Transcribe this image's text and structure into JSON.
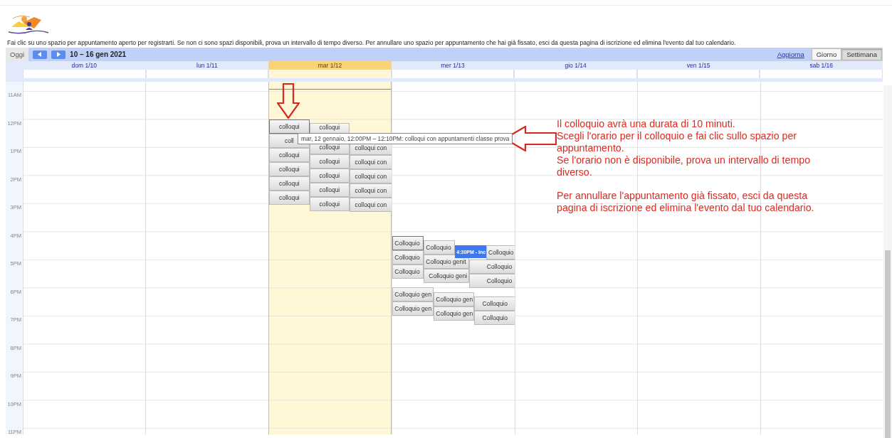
{
  "instructions": "Fai clic su uno spazio per appuntamento aperto per registrarti. Se non ci sono spazi disponibili, prova un intervallo di tempo diverso. Per annullare uno spazio per appuntamento che hai già fissato, esci da questa pagina di iscrizione ed elimina l'evento dal tuo calendario.",
  "toolbar": {
    "today": "Oggi",
    "range": "10 – 16 gen 2021",
    "refresh": "Aggiorna",
    "views": [
      {
        "label": "Giorno",
        "selected": false
      },
      {
        "label": "Settimana",
        "selected": true
      }
    ]
  },
  "days": [
    {
      "label": "dom 1/10",
      "today": false
    },
    {
      "label": "lun 1/11",
      "today": false
    },
    {
      "label": "mar 1/12",
      "today": true,
      "events": [
        {
          "label": "colloqui",
          "kind": "slot"
        },
        {
          "label": "coll",
          "kind": "slot"
        },
        {
          "label": "colloqui",
          "kind": "slot"
        },
        {
          "label": "colloqui",
          "kind": "slot"
        },
        {
          "label": "colloqui",
          "kind": "slot"
        },
        {
          "label": "colloqui",
          "kind": "slot"
        },
        {
          "label": "colloqui",
          "kind": "slot"
        },
        {
          "label": "colloqui",
          "kind": "slot"
        },
        {
          "label": "colloqui",
          "kind": "slot"
        },
        {
          "label": "colloqui",
          "kind": "slot"
        },
        {
          "label": "colloqui",
          "kind": "slot"
        },
        {
          "label": "colloqui",
          "kind": "slot"
        },
        {
          "label": "colloqui con",
          "kind": "slot"
        },
        {
          "label": "colloqui con",
          "kind": "slot"
        },
        {
          "label": "colloqui con",
          "kind": "slot"
        },
        {
          "label": "colloqui con",
          "kind": "slot"
        },
        {
          "label": "colloqui con",
          "kind": "slot"
        }
      ]
    },
    {
      "label": "mer 1/13",
      "today": false,
      "events": [
        {
          "label": "Colloquio",
          "kind": "slot"
        },
        {
          "label": "Colloquio",
          "kind": "slot"
        },
        {
          "label": "Colloquio",
          "kind": "slot"
        },
        {
          "label": "Colloquio gen",
          "kind": "slot"
        },
        {
          "label": "Colloquio gen",
          "kind": "slot"
        },
        {
          "label": "Colloquio",
          "kind": "slot"
        },
        {
          "label": "Colloquio genit",
          "kind": "slot"
        },
        {
          "label": "Colloquio geni",
          "kind": "slot"
        },
        {
          "label": "Colloquio",
          "kind": "slot"
        },
        {
          "label": "Colloquio",
          "kind": "slot"
        },
        {
          "label": "Colloquio",
          "kind": "slot"
        },
        {
          "label": "4:30PM - Inc",
          "kind": "booked"
        },
        {
          "label": "Colloquio gen",
          "kind": "slot"
        },
        {
          "label": "Colloquio gen",
          "kind": "slot"
        },
        {
          "label": "Colloquio",
          "kind": "slot"
        },
        {
          "label": "Colloquio",
          "kind": "slot"
        }
      ]
    },
    {
      "label": "gio 1/14",
      "today": false
    },
    {
      "label": "ven 1/15",
      "today": false
    },
    {
      "label": "sab 1/16",
      "today": false
    }
  ],
  "hours": [
    "11AM",
    "12PM",
    "1PM",
    "2PM",
    "3PM",
    "4PM",
    "5PM",
    "6PM",
    "7PM",
    "8PM",
    "9PM",
    "10PM",
    "11PM"
  ],
  "tooltip": "mar, 12 gennaio, 12:00PM – 12:10PM: colloqui con appuntamenti classe prova",
  "note": {
    "paragraphs": [
      [
        "Il colloquio avrà una durata di 10 minuti.",
        "Scegli l'orario per il colloquio e fai clic sullo spazio per appuntamento.",
        "Se l'orario non è disponibile, prova un intervallo di tempo diverso."
      ],
      [
        "Per annullare l'appuntamento già fissato, esci da questa pagina di iscrizione ed elimina l'evento dal tuo calendario."
      ]
    ]
  }
}
